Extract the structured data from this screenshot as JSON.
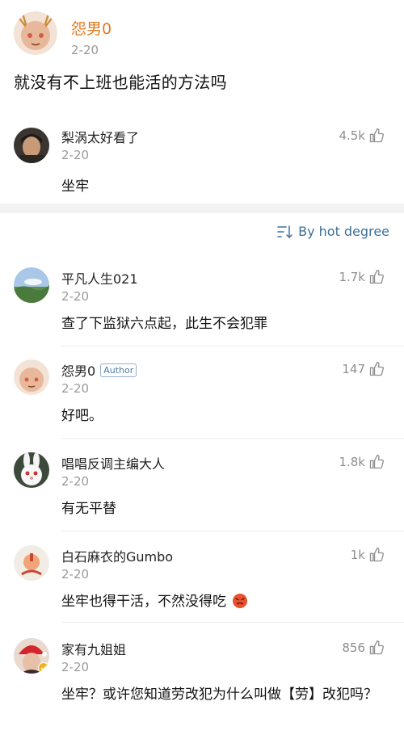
{
  "post": {
    "username": "怨男0",
    "date": "2-20",
    "text": "就没有不上班也能活的方法吗",
    "hot_comment": {
      "username": "梨涡太好看了",
      "date": "2-20",
      "text": "坐牢",
      "likes": "4.5k"
    }
  },
  "sort": {
    "label": "By hot degree"
  },
  "comments": [
    {
      "username": "平凡人生021",
      "date": "2-20",
      "text": "查了下监狱六点起，此生不会犯罪",
      "likes": "1.7k"
    },
    {
      "username": "怨男0",
      "badge": "Author",
      "date": "2-20",
      "text": "好吧。",
      "likes": "147"
    },
    {
      "username": "唱唱反调主编大人",
      "date": "2-20",
      "text": "有无平替",
      "likes": "1.8k"
    },
    {
      "username": "白石麻衣的Gumbo",
      "date": "2-20",
      "text": "坐牢也得干活，不然没得吃",
      "likes": "1k"
    },
    {
      "username": "家有九姐姐",
      "date": "2-20",
      "text": "坐牢？或许您知道劳改犯为什么叫做【劳】改犯吗？",
      "likes": "856"
    }
  ],
  "colors": {
    "author_name": "#e07b1f",
    "link_blue": "#3e6f99",
    "muted": "#9a9a9a"
  }
}
